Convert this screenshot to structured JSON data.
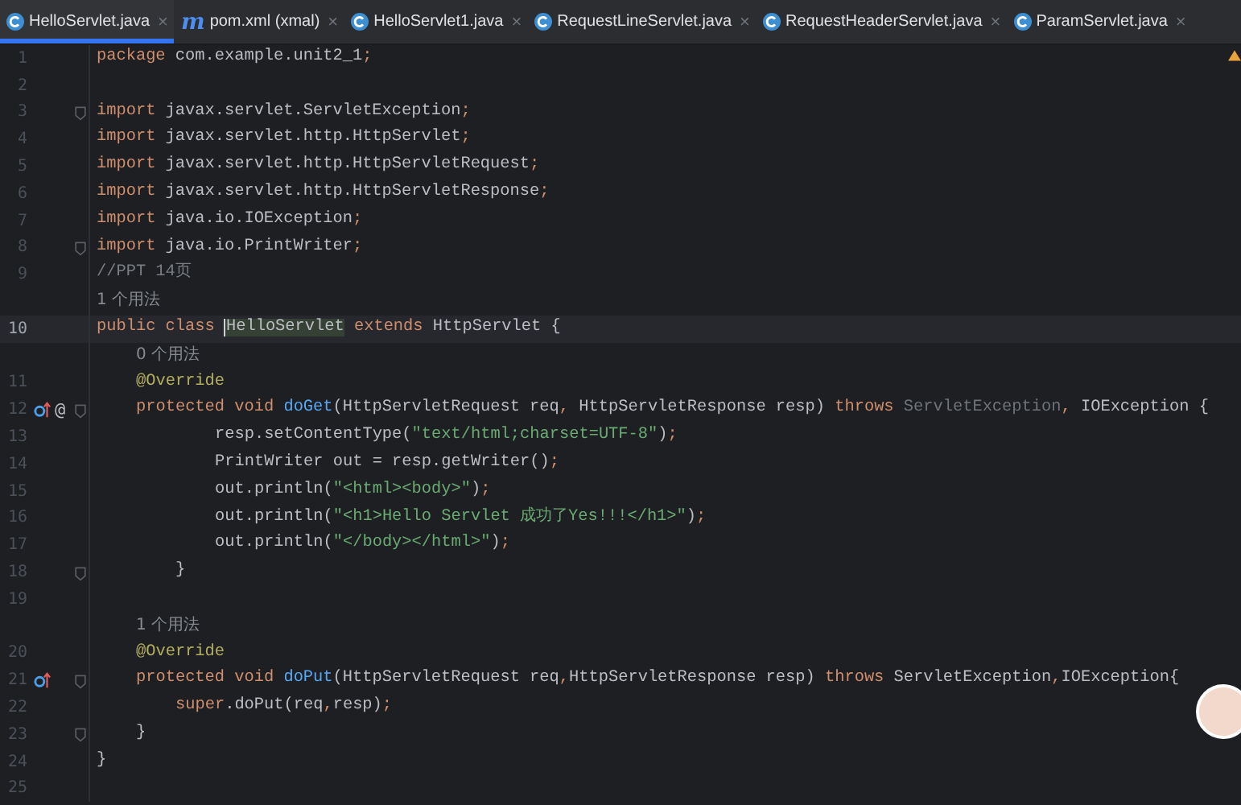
{
  "tabs": [
    {
      "label": "HelloServlet.java",
      "kind": "class",
      "close": "×",
      "selected": true
    },
    {
      "label": "pom.xml (xmal)",
      "kind": "maven",
      "icon_text": "m",
      "close": "×",
      "selected": false
    },
    {
      "label": "HelloServlet1.java",
      "kind": "class",
      "close": "×",
      "selected": false
    },
    {
      "label": "RequestLineServlet.java",
      "kind": "class",
      "close": "×",
      "selected": false
    },
    {
      "label": "RequestHeaderServlet.java",
      "kind": "class",
      "close": "×",
      "selected": false
    },
    {
      "label": "ParamServlet.java",
      "kind": "class",
      "close": "×",
      "selected": false
    }
  ],
  "lines": [
    {
      "kind": "code",
      "number": "1",
      "current": false,
      "fold": false,
      "override": false,
      "tokens": [
        {
          "kind": "kw",
          "text": "package"
        },
        {
          "kind": "plain",
          "text": " com.example.unit2_1"
        },
        {
          "kind": "kw",
          "text": ";"
        }
      ]
    },
    {
      "kind": "code",
      "number": "2",
      "current": false,
      "fold": false,
      "override": false
    },
    {
      "kind": "code",
      "number": "3",
      "current": false,
      "fold": true,
      "override": false,
      "tokens": [
        {
          "kind": "kw",
          "text": "import"
        },
        {
          "kind": "plain",
          "text": " javax.servlet.ServletException"
        },
        {
          "kind": "kw",
          "text": ";"
        }
      ]
    },
    {
      "kind": "code",
      "number": "4",
      "current": false,
      "fold": false,
      "override": false,
      "tokens": [
        {
          "kind": "kw",
          "text": "import"
        },
        {
          "kind": "plain",
          "text": " javax.servlet.http.HttpServlet"
        },
        {
          "kind": "kw",
          "text": ";"
        }
      ]
    },
    {
      "kind": "code",
      "number": "5",
      "current": false,
      "fold": false,
      "override": false,
      "tokens": [
        {
          "kind": "kw",
          "text": "import"
        },
        {
          "kind": "plain",
          "text": " javax.servlet.http.HttpServletRequest"
        },
        {
          "kind": "kw",
          "text": ";"
        }
      ]
    },
    {
      "kind": "code",
      "number": "6",
      "current": false,
      "fold": false,
      "override": false,
      "tokens": [
        {
          "kind": "kw",
          "text": "import"
        },
        {
          "kind": "plain",
          "text": " javax.servlet.http.HttpServletResponse"
        },
        {
          "kind": "kw",
          "text": ";"
        }
      ]
    },
    {
      "kind": "code",
      "number": "7",
      "current": false,
      "fold": false,
      "override": false,
      "tokens": [
        {
          "kind": "kw",
          "text": "import"
        },
        {
          "kind": "plain",
          "text": " java.io.IOException"
        },
        {
          "kind": "kw",
          "text": ";"
        }
      ]
    },
    {
      "kind": "code",
      "number": "8",
      "current": false,
      "fold": true,
      "override": false,
      "tokens": [
        {
          "kind": "kw",
          "text": "import"
        },
        {
          "kind": "plain",
          "text": " java.io.PrintWriter"
        },
        {
          "kind": "kw",
          "text": ";"
        }
      ]
    },
    {
      "kind": "code",
      "number": "9",
      "current": false,
      "fold": false,
      "override": false,
      "tokens": [
        {
          "kind": "cmt",
          "text": "//PPT 14页"
        }
      ]
    },
    {
      "kind": "hint",
      "text": "1 个用法"
    },
    {
      "kind": "code",
      "number": "10",
      "current": true,
      "fold": false,
      "override": false,
      "tokens": [
        {
          "kind": "kw",
          "text": "public class "
        },
        {
          "kind": "selection",
          "text": "HelloServlet"
        },
        {
          "kind": "kw",
          "text": " extends "
        },
        {
          "kind": "plain",
          "text": "HttpServlet {"
        }
      ]
    },
    {
      "kind": "hint",
      "text": "\t0 个用法"
    },
    {
      "kind": "code",
      "number": "11",
      "current": false,
      "fold": false,
      "override": false,
      "tokens": [
        {
          "kind": "ann",
          "text": "\t@Override"
        }
      ]
    },
    {
      "kind": "code",
      "number": "12",
      "current": false,
      "fold": true,
      "override": true,
      "gutter_text": "@",
      "tokens": [
        {
          "kind": "kw",
          "text": "\tprotected void "
        },
        {
          "kind": "fn",
          "text": "doGet"
        },
        {
          "kind": "plain",
          "text": "(HttpServletRequest req"
        },
        {
          "kind": "kw",
          "text": ","
        },
        {
          "kind": "plain",
          "text": " HttpServletResponse resp) "
        },
        {
          "kind": "kw",
          "text": "throws "
        },
        {
          "kind": "dim",
          "text": "ServletException"
        },
        {
          "kind": "kw",
          "text": ","
        },
        {
          "kind": "plain",
          "text": " IOException {"
        }
      ]
    },
    {
      "kind": "code",
      "number": "13",
      "current": false,
      "fold": false,
      "override": false,
      "tokens": [
        {
          "kind": "plain",
          "text": "\t\t\tresp.setContentType("
        },
        {
          "kind": "str",
          "text": "\"text/html;charset=UTF-8\""
        },
        {
          "kind": "plain",
          "text": ")"
        },
        {
          "kind": "kw",
          "text": ";"
        }
      ]
    },
    {
      "kind": "code",
      "number": "14",
      "current": false,
      "fold": false,
      "override": false,
      "tokens": [
        {
          "kind": "plain",
          "text": "\t\t\tPrintWriter out = resp.getWriter()"
        },
        {
          "kind": "kw",
          "text": ";"
        }
      ]
    },
    {
      "kind": "code",
      "number": "15",
      "current": false,
      "fold": false,
      "override": false,
      "tokens": [
        {
          "kind": "plain",
          "text": "\t\t\tout.println("
        },
        {
          "kind": "str",
          "text": "\"<html><body>\""
        },
        {
          "kind": "plain",
          "text": ")"
        },
        {
          "kind": "kw",
          "text": ";"
        }
      ]
    },
    {
      "kind": "code",
      "number": "16",
      "current": false,
      "fold": false,
      "override": false,
      "tokens": [
        {
          "kind": "plain",
          "text": "\t\t\tout.println("
        },
        {
          "kind": "str",
          "text": "\"<h1>Hello Servlet 成功了Yes!!!</h1>\""
        },
        {
          "kind": "plain",
          "text": ")"
        },
        {
          "kind": "kw",
          "text": ";"
        }
      ]
    },
    {
      "kind": "code",
      "number": "17",
      "current": false,
      "fold": false,
      "override": false,
      "tokens": [
        {
          "kind": "plain",
          "text": "\t\t\tout.println("
        },
        {
          "kind": "str",
          "text": "\"</body></html>\""
        },
        {
          "kind": "plain",
          "text": ")"
        },
        {
          "kind": "kw",
          "text": ";"
        }
      ]
    },
    {
      "kind": "code",
      "number": "18",
      "current": false,
      "fold": true,
      "override": false,
      "tokens": [
        {
          "kind": "plain",
          "text": "\t\t}"
        }
      ]
    },
    {
      "kind": "code",
      "number": "19",
      "current": false,
      "fold": false,
      "override": false
    },
    {
      "kind": "hint",
      "text": "\t1 个用法"
    },
    {
      "kind": "code",
      "number": "20",
      "current": false,
      "fold": false,
      "override": false,
      "tokens": [
        {
          "kind": "ann",
          "text": "\t@Override"
        }
      ]
    },
    {
      "kind": "code",
      "number": "21",
      "current": false,
      "fold": true,
      "override": true,
      "tokens": [
        {
          "kind": "kw",
          "text": "\tprotected void "
        },
        {
          "kind": "fn",
          "text": "doPut"
        },
        {
          "kind": "plain",
          "text": "(HttpServletRequest req"
        },
        {
          "kind": "kw",
          "text": ","
        },
        {
          "kind": "plain",
          "text": "HttpServletResponse resp) "
        },
        {
          "kind": "kw",
          "text": "throws "
        },
        {
          "kind": "plain",
          "text": "ServletException"
        },
        {
          "kind": "kw",
          "text": ","
        },
        {
          "kind": "plain",
          "text": "IOException{"
        }
      ]
    },
    {
      "kind": "code",
      "number": "22",
      "current": false,
      "fold": false,
      "override": false,
      "tokens": [
        {
          "kind": "kw",
          "text": "\t\tsuper"
        },
        {
          "kind": "plain",
          "text": ".doPut(req"
        },
        {
          "kind": "kw",
          "text": ","
        },
        {
          "kind": "plain",
          "text": "resp)"
        },
        {
          "kind": "kw",
          "text": ";"
        }
      ]
    },
    {
      "kind": "code",
      "number": "23",
      "current": false,
      "fold": true,
      "override": false,
      "tokens": [
        {
          "kind": "plain",
          "text": "\t}"
        }
      ]
    },
    {
      "kind": "code",
      "number": "24",
      "current": false,
      "fold": false,
      "override": false,
      "tokens": [
        {
          "kind": "plain",
          "text": "}"
        }
      ]
    },
    {
      "kind": "code",
      "number": "25",
      "current": false,
      "fold": false,
      "override": false
    }
  ]
}
